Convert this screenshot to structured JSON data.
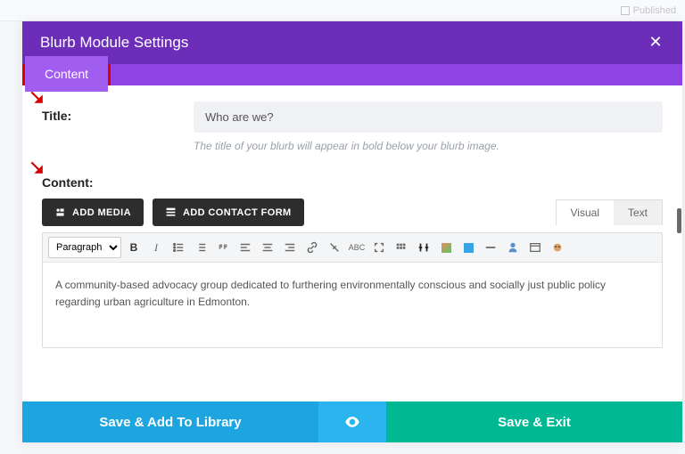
{
  "backdrop": {
    "publish_label": "Published"
  },
  "modal": {
    "title": "Blurb Module Settings",
    "tabs": {
      "content": "Content"
    }
  },
  "fields": {
    "title_label": "Title:",
    "title_value": "Who are we?",
    "title_help": "The title of your blurb will appear in bold below your blurb image.",
    "content_label": "Content:"
  },
  "buttons": {
    "add_media": "ADD MEDIA",
    "add_contact_form": "ADD CONTACT FORM"
  },
  "editor_tabs": {
    "visual": "Visual",
    "text": "Text"
  },
  "toolbar": {
    "format_select": "Paragraph"
  },
  "content_body": "A community-based advocacy group dedicated to furthering environmentally conscious and socially just public policy regarding urban agriculture in Edmonton.",
  "footer": {
    "save_library": "Save & Add To Library",
    "save_exit": "Save & Exit"
  }
}
